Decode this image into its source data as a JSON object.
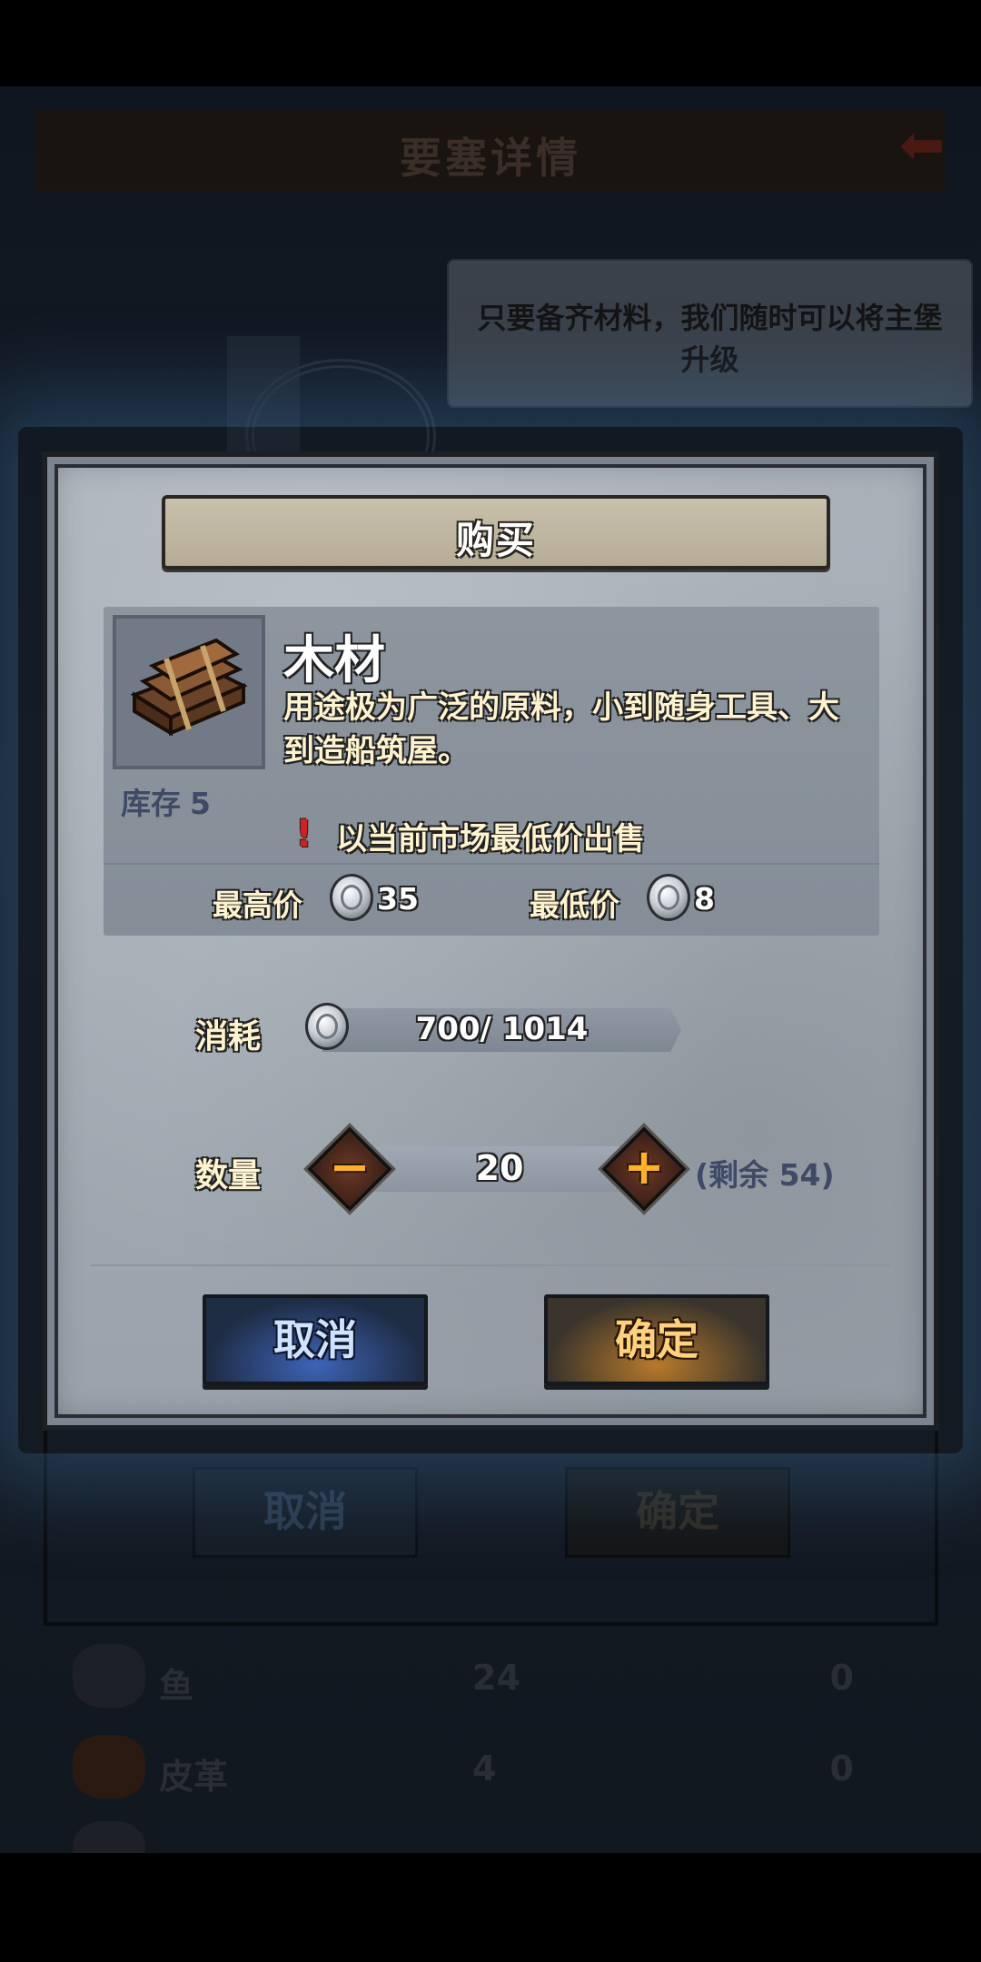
{
  "background": {
    "header_title": "要塞详情",
    "tooltip_text": "只要备齐材料，我们随时可以将主堡升级",
    "cancel_label": "取消",
    "confirm_label": "确定",
    "rows": [
      {
        "name": "鱼",
        "col1": "24",
        "col2": "0"
      },
      {
        "name": "皮革",
        "col1": "4",
        "col2": "0"
      }
    ]
  },
  "dialog": {
    "title": "购买",
    "item": {
      "name": "木材",
      "description": "用途极为广泛的原料，小到随身工具、大到造船筑屋。",
      "stock_label": "库存",
      "stock_value": "5",
      "icon": "wood-planks-icon"
    },
    "notice": "以当前市场最低价出售",
    "max_price_label": "最高价",
    "max_price_value": "35",
    "min_price_label": "最低价",
    "min_price_value": "8",
    "cost_label": "消耗",
    "cost_text": "700/ 1014",
    "quantity_label": "数量",
    "quantity_value": "20",
    "remaining_text": "(剩余 54)",
    "cancel_label": "取消",
    "confirm_label": "确定"
  },
  "colors": {
    "cancel_accent": "#3e64b8",
    "confirm_accent": "#b87a2a",
    "label_text": "#fff3cf",
    "stock_text": "#3e4a66"
  }
}
